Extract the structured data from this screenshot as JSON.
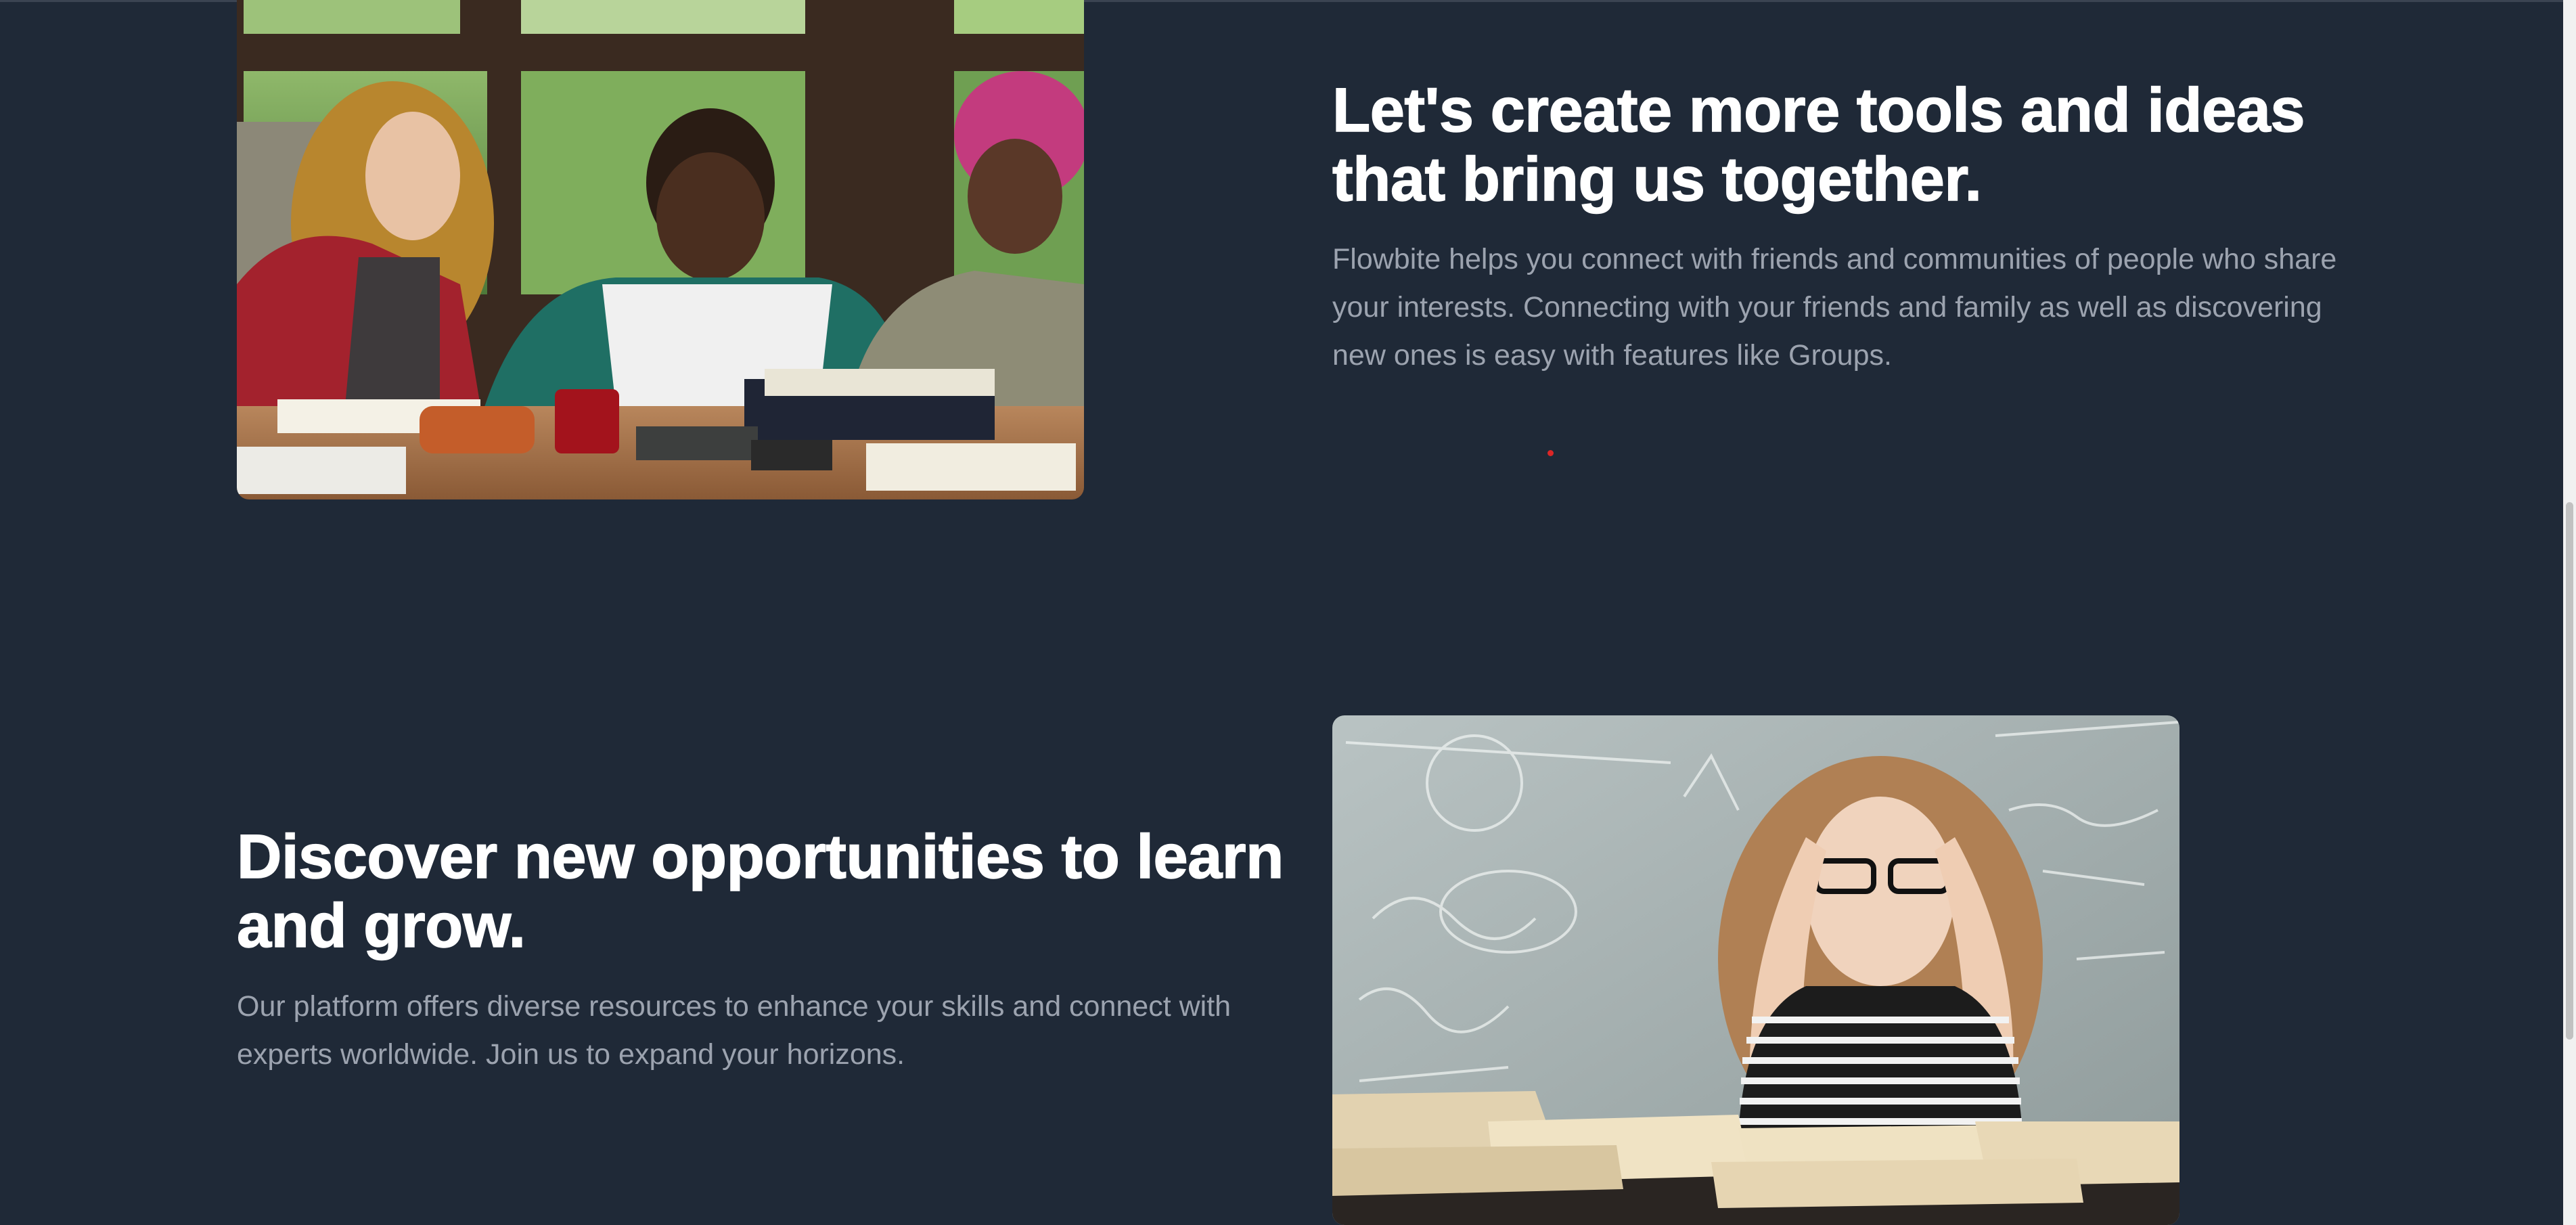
{
  "features": [
    {
      "title": "Let's create more tools and ideas that bring us together.",
      "description": "Flowbite helps you connect with friends and communities of people who share your interests. Connecting with your friends and family as well as discovering new ones is easy with features like Groups.",
      "image_subject": "students studying at a table"
    },
    {
      "title": "Discover new opportunities to learn and grow.",
      "description": "Our platform offers diverse resources to enhance your skills and connect with experts worldwide. Join us to expand your horizons.",
      "image_subject": "stressed student with books in front of chalkboard"
    }
  ],
  "colors": {
    "background": "#1f2937",
    "heading": "#ffffff",
    "body_text": "#9ca3af",
    "dot": "#dc2626"
  }
}
